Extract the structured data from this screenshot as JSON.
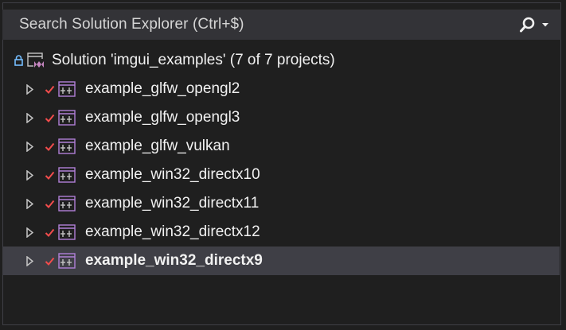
{
  "search": {
    "placeholder": "Search Solution Explorer (Ctrl+$)"
  },
  "solution": {
    "label": "Solution 'imgui_examples' (7 of 7 projects)"
  },
  "projects": [
    {
      "label": "example_glfw_opengl2"
    },
    {
      "label": "example_glfw_opengl3"
    },
    {
      "label": "example_glfw_vulkan"
    },
    {
      "label": "example_win32_directx10"
    },
    {
      "label": "example_win32_directx11"
    },
    {
      "label": "example_win32_directx12"
    },
    {
      "label": "example_win32_directx9"
    }
  ],
  "icons": {
    "search": "search-icon",
    "dropdown": "dropdown-arrow-icon",
    "lock": "lock-icon",
    "solution": "solution-icon",
    "expand": "expand-arrow-icon",
    "check": "checkmark-icon",
    "project": "cpp-project-icon"
  },
  "colors": {
    "accent_blue": "#75beff",
    "check_red": "#f14c4c",
    "project_purple": "#b180d7",
    "solution_purple": "#c586c0"
  }
}
